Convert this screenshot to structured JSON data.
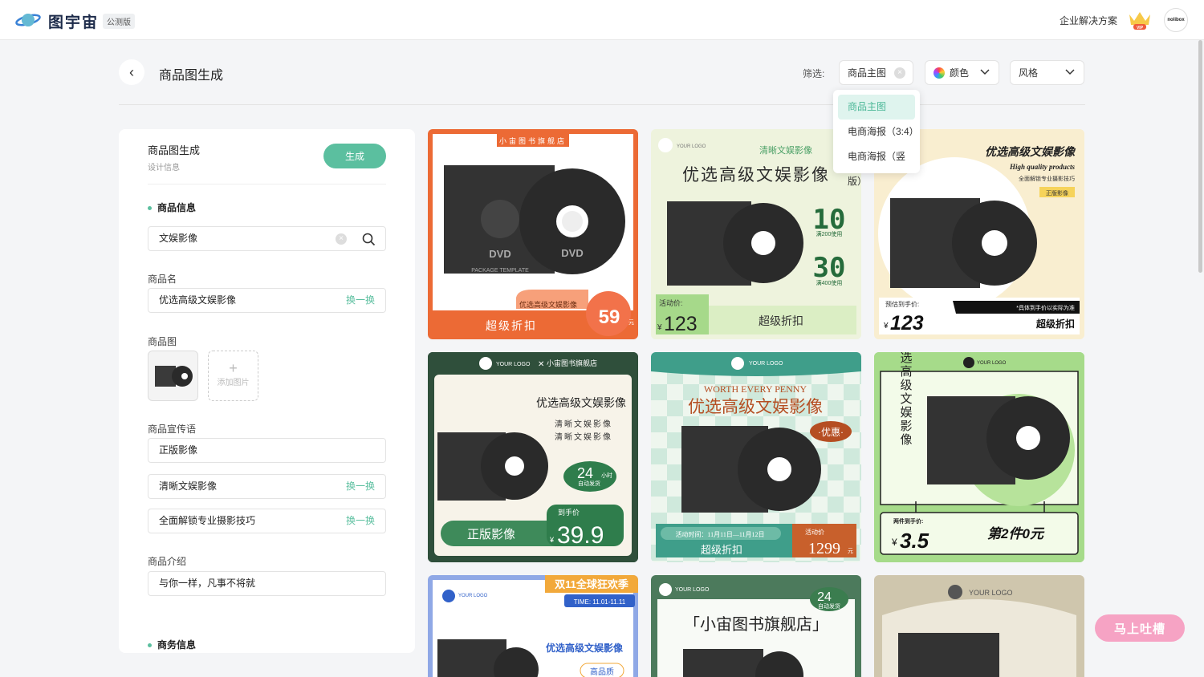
{
  "header": {
    "app_name": "图宇宙",
    "beta_badge": "公测版",
    "enterprise_link": "企业解决方案",
    "vip_label": "VIP",
    "avatar_text": "nolibox"
  },
  "page": {
    "title": "商品图生成",
    "filter_label": "筛选:"
  },
  "filters": {
    "product_main": "商品主图",
    "color": "颜色",
    "style": "风格"
  },
  "dropdown": {
    "items": [
      "商品主图",
      "电商海报（3:4）",
      "电商海报（竖版）"
    ]
  },
  "panel": {
    "title": "商品图生成",
    "subtitle": "设计信息",
    "generate_button": "生成",
    "section_product": "商品信息",
    "search_value": "文娱影像",
    "product_name_label": "商品名",
    "product_name_value": "优选高级文娱影像",
    "swap_label": "换一换",
    "product_image_label": "商品图",
    "add_image_label": "添加图片",
    "slogan_label": "商品宣传语",
    "slogans": [
      "正版影像",
      "清晰文娱影像",
      "全面解锁专业摄影技巧"
    ],
    "intro_label": "商品介绍",
    "intro_value": "与你一样，凡事不将就",
    "section_business": "商务信息"
  },
  "cards": {
    "c1": {
      "shop": "小宙图书旗舰店",
      "name": "优选高级文娱影像",
      "price": "59",
      "unit": "元",
      "footer": "超级折扣",
      "dvd": "DVD",
      "pkg": "PACKAGE TEMPLATE"
    },
    "c2": {
      "logo": "YOUR LOGO",
      "tag": "清晰文娱影像",
      "title": "优选高级文娱影像",
      "c1v": "10",
      "c1d": "满200使用",
      "c2v": "30",
      "c2d": "满400使用",
      "price_label": "活动价:",
      "price": "123",
      "footer": "超级折扣"
    },
    "c3": {
      "title": "优选高级文娱影像",
      "en": "High quality products",
      "sub": "全面解锁专业摄影技巧",
      "badge": "正版影像",
      "price_label": "预估到手价:",
      "note": "*具体到手价以实际为准",
      "price": "123",
      "footer": "超级折扣"
    },
    "c4": {
      "logo": "YOUR LOGO",
      "x": "✕",
      "shop": "小宙图书旗舰店",
      "title": "优选高级文娱影像",
      "l1": "清晰文娱影像",
      "l2": "清晰文娱影像",
      "hours": "24",
      "hours_unit": "小时",
      "ship": "自动发货",
      "price_label": "到手价",
      "price": "39.9",
      "footer": "正版影像"
    },
    "c5": {
      "logo": "YOUR LOGO",
      "en": "WORTH EVERY PENNY",
      "title": "优选高级文娱影像",
      "badge": "·优惠·",
      "time": "活动时间：11月11日—11月12日",
      "footer": "超级折扣",
      "price_label": "活动价",
      "price": "1299",
      "unit": "元"
    },
    "c6": {
      "logo": "YOUR LOGO",
      "vertical": "优选高级文娱影像",
      "price_label": "两件到手价:",
      "price": "3.5",
      "second": "第2件0元"
    },
    "c7": {
      "logo": "YOUR LOGO",
      "banner": "双11全球狂欢季",
      "time": "TIME: 11.01-11.11",
      "title": "优选高级文娱影像",
      "tag": "高品质"
    },
    "c8": {
      "logo": "YOUR LOGO",
      "hours": "24",
      "ship": "自动发货",
      "title": "「小宙图书旗舰店」"
    },
    "c9": {
      "logo": "YOUR LOGO"
    }
  },
  "currency": "¥",
  "feedback_button": "马上吐槽",
  "colors": {
    "accent": "#5bbf9f",
    "orange": "#ec6a35",
    "green_dark": "#2f4f3b"
  }
}
